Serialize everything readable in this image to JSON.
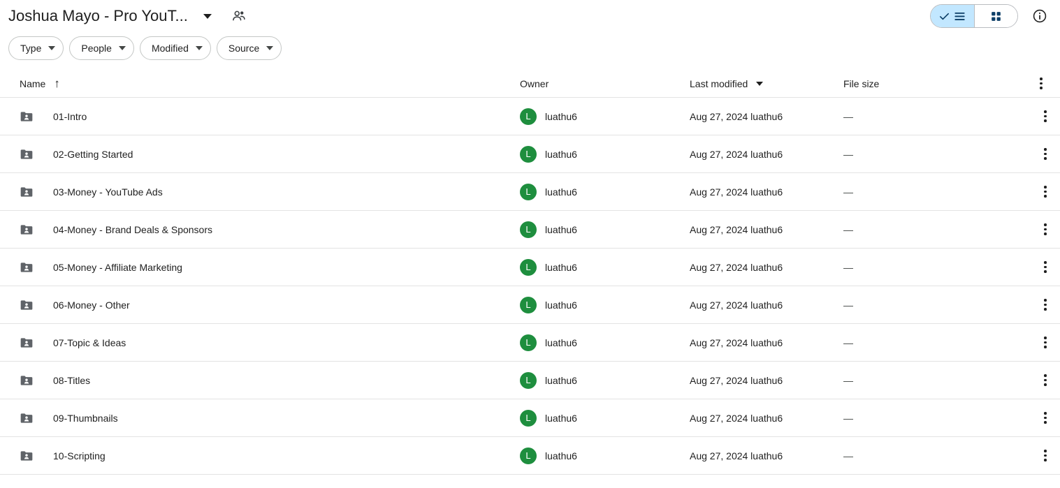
{
  "header": {
    "title": "Joshua Mayo - Pro YouT...",
    "title_caret_icon": "chevron-down-icon",
    "people_icon": "people-shared-icon",
    "view_toggle": {
      "list_label": "List view",
      "list_icon": "list-view-icon",
      "check_icon": "check-icon",
      "grid_label": "Grid view",
      "grid_icon": "grid-view-icon",
      "active": "list"
    },
    "info_icon": "info-circle-icon",
    "info_label": "View details"
  },
  "filters": [
    {
      "label": "Type",
      "caret_icon": "chevron-down-icon"
    },
    {
      "label": "People",
      "caret_icon": "chevron-down-icon"
    },
    {
      "label": "Modified",
      "caret_icon": "chevron-down-icon"
    },
    {
      "label": "Source",
      "caret_icon": "chevron-down-icon"
    }
  ],
  "table": {
    "columns": {
      "name": "Name",
      "name_sort_icon": "arrow-up-icon",
      "owner": "Owner",
      "last_modified": "Last modified",
      "last_modified_sort_icon": "chevron-down-icon",
      "file_size": "File size"
    },
    "header_kebab_icon": "more-options-icon",
    "rows": [
      {
        "icon": "shared-folder-icon",
        "name": "01-Intro",
        "owner_initial": "L",
        "owner": "luathu6",
        "modified": "Aug 27, 2024 luathu6",
        "size": "—",
        "kebab_icon": "more-options-icon"
      },
      {
        "icon": "shared-folder-icon",
        "name": "02-Getting Started",
        "owner_initial": "L",
        "owner": "luathu6",
        "modified": "Aug 27, 2024 luathu6",
        "size": "—",
        "kebab_icon": "more-options-icon"
      },
      {
        "icon": "shared-folder-icon",
        "name": "03-Money - YouTube Ads",
        "owner_initial": "L",
        "owner": "luathu6",
        "modified": "Aug 27, 2024 luathu6",
        "size": "—",
        "kebab_icon": "more-options-icon"
      },
      {
        "icon": "shared-folder-icon",
        "name": "04-Money - Brand Deals & Sponsors",
        "owner_initial": "L",
        "owner": "luathu6",
        "modified": "Aug 27, 2024 luathu6",
        "size": "—",
        "kebab_icon": "more-options-icon"
      },
      {
        "icon": "shared-folder-icon",
        "name": "05-Money - Affiliate Marketing",
        "owner_initial": "L",
        "owner": "luathu6",
        "modified": "Aug 27, 2024 luathu6",
        "size": "—",
        "kebab_icon": "more-options-icon"
      },
      {
        "icon": "shared-folder-icon",
        "name": "06-Money - Other",
        "owner_initial": "L",
        "owner": "luathu6",
        "modified": "Aug 27, 2024 luathu6",
        "size": "—",
        "kebab_icon": "more-options-icon"
      },
      {
        "icon": "shared-folder-icon",
        "name": "07-Topic & Ideas",
        "owner_initial": "L",
        "owner": "luathu6",
        "modified": "Aug 27, 2024 luathu6",
        "size": "—",
        "kebab_icon": "more-options-icon"
      },
      {
        "icon": "shared-folder-icon",
        "name": "08-Titles",
        "owner_initial": "L",
        "owner": "luathu6",
        "modified": "Aug 27, 2024 luathu6",
        "size": "—",
        "kebab_icon": "more-options-icon"
      },
      {
        "icon": "shared-folder-icon",
        "name": "09-Thumbnails",
        "owner_initial": "L",
        "owner": "luathu6",
        "modified": "Aug 27, 2024 luathu6",
        "size": "—",
        "kebab_icon": "more-options-icon"
      },
      {
        "icon": "shared-folder-icon",
        "name": "10-Scripting",
        "owner_initial": "L",
        "owner": "luathu6",
        "modified": "Aug 27, 2024 luathu6",
        "size": "—",
        "kebab_icon": "more-options-icon"
      }
    ]
  },
  "colors": {
    "accent_active": "#c2e7ff",
    "avatar_green": "#1e8e3e",
    "folder_gray": "#5f6368",
    "text_primary": "#1f1f1f",
    "divider": "#e3e3e3"
  }
}
